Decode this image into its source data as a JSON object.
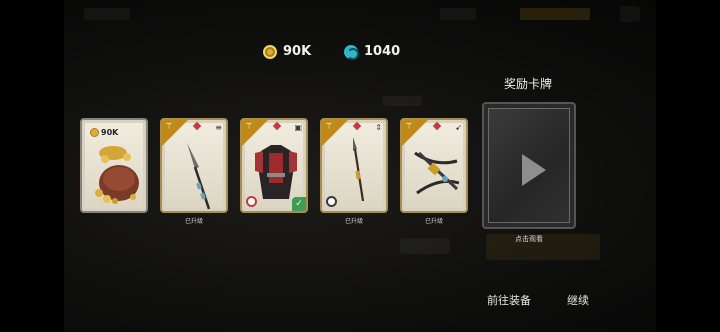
{
  "currency": {
    "coins": "90K",
    "gems": "1040"
  },
  "cards": [
    {
      "kind": "coins",
      "amount": "90K",
      "label": ""
    },
    {
      "kind": "weapon-glaive",
      "label": "已升级"
    },
    {
      "kind": "armor",
      "label": ""
    },
    {
      "kind": "weapon-spear",
      "label": "已升级"
    },
    {
      "kind": "weapon-crossbow",
      "label": "已升级"
    }
  ],
  "reward": {
    "title": "奖励卡牌",
    "video_label": "点击观看"
  },
  "buttons": {
    "equip": "前往装备",
    "continue": "继续"
  },
  "colors": {
    "banner_gold": "#c08a1a",
    "rarity_red": "#c23a3a",
    "equipped_green": "#3f9c55"
  }
}
